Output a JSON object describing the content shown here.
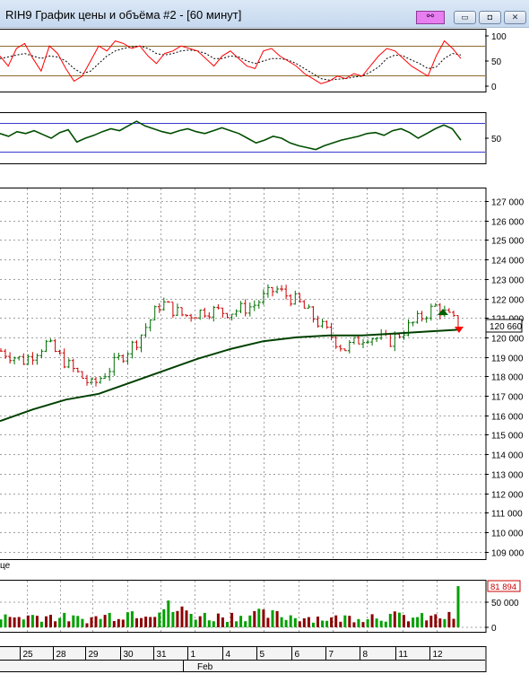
{
  "window": {
    "title": "RIH9 График цены и объёма #2 - [60 минут]",
    "link_icon": "link-icon",
    "buttons": {
      "minimize": "minimize-icon",
      "restore": "restore-icon",
      "close": "close-icon"
    }
  },
  "oscillator_panel": {
    "y_ticks": [
      "100",
      "50",
      "0"
    ],
    "colors": {
      "fast": "#ff0000",
      "slow": "#000000",
      "bands": "#8b6b2a"
    }
  },
  "momentum_panel": {
    "y_ticks": [
      "50"
    ],
    "colors": {
      "line": "#004d00",
      "bands": "#3a3acf"
    }
  },
  "price_panel": {
    "y_ticks": [
      "127 000",
      "126 000",
      "125 000",
      "124 000",
      "123 000",
      "122 000",
      "121 000",
      "120 000",
      "119 000",
      "118 000",
      "117 000",
      "116 000",
      "115 000",
      "114 000",
      "113 000",
      "112 000",
      "111 000",
      "110 000",
      "109 000"
    ],
    "last_price_label": "120 660",
    "bottom_left_fragment": "це",
    "colors": {
      "up": "#007000",
      "down": "#cc0000",
      "ma": "#004000",
      "grid": "#a0a0a0"
    }
  },
  "volume_panel": {
    "y_ticks": [
      "50 000",
      "0"
    ],
    "last_volume_label": "81 894",
    "colors": {
      "up": "#00a000",
      "down": "#8b0000"
    }
  },
  "date_axis": {
    "days": [
      "25",
      "28",
      "29",
      "30",
      "31",
      "1",
      "4",
      "5",
      "6",
      "7",
      "8",
      "11",
      "12"
    ],
    "month_label": "Feb"
  },
  "chart_data": [
    {
      "type": "line",
      "title": "",
      "y_ticks": [
        0,
        50,
        100
      ],
      "ylim": [
        0,
        100
      ],
      "series": [
        {
          "values": [
            60,
            40,
            75,
            85,
            55,
            30,
            80,
            65,
            35,
            10,
            20,
            50,
            80,
            70,
            90,
            85,
            75,
            80,
            60,
            45,
            65,
            70,
            80,
            75,
            70,
            55,
            40,
            60,
            70,
            55,
            40,
            35,
            70,
            75,
            60,
            50,
            40,
            25,
            15,
            5,
            10,
            20,
            15,
            25,
            20,
            40,
            60,
            75,
            70,
            55,
            40,
            30,
            20,
            60,
            90,
            75,
            55
          ]
        },
        {
          "values": [
            55,
            58,
            62,
            65,
            60,
            55,
            60,
            58,
            50,
            35,
            25,
            30,
            45,
            60,
            70,
            75,
            78,
            80,
            75,
            65,
            62,
            65,
            70,
            72,
            70,
            65,
            55,
            55,
            60,
            58,
            50,
            45,
            50,
            55,
            55,
            52,
            45,
            35,
            25,
            15,
            12,
            14,
            15,
            18,
            20,
            28,
            38,
            55,
            62,
            60,
            52,
            45,
            35,
            38,
            55,
            65,
            62
          ]
        }
      ]
    },
    {
      "type": "line",
      "title": "",
      "y_ticks": [
        50
      ],
      "series": [
        {
          "values": [
            55,
            52,
            57,
            55,
            58,
            54,
            50,
            56,
            59,
            46,
            50,
            53,
            57,
            60,
            58,
            63,
            68,
            63,
            60,
            57,
            55,
            58,
            60,
            57,
            55,
            58,
            61,
            58,
            55,
            50,
            45,
            48,
            52,
            50,
            45,
            42,
            40,
            38,
            42,
            45,
            48,
            50,
            52,
            55,
            56,
            53,
            58,
            60,
            56,
            50,
            55,
            60,
            64,
            60,
            48
          ]
        }
      ]
    },
    {
      "type": "line",
      "title": "",
      "ylim": [
        108500,
        127500
      ],
      "x": [
        "25",
        "28",
        "29",
        "30",
        "31",
        "1",
        "4",
        "5",
        "6",
        "7",
        "8",
        "11",
        "12"
      ],
      "series": [
        {
          "values": [
            119300,
            118800,
            119700,
            118500,
            117500,
            118700,
            119900,
            121800,
            121100,
            121400,
            121300,
            121600,
            122500,
            121800,
            120600,
            119400,
            120100,
            119800,
            120700,
            121600,
            120660
          ]
        },
        {
          "values": [
            115700,
            116300,
            116800,
            117100,
            117700,
            118300,
            118900,
            119400,
            119800,
            120000,
            120100,
            120100,
            120200,
            120300,
            120400
          ]
        }
      ]
    },
    {
      "type": "bar",
      "title": "",
      "y_ticks": [
        0,
        50000
      ],
      "categories": [
        "25",
        "28",
        "29",
        "30",
        "31",
        "1",
        "4",
        "5",
        "6",
        "7",
        "8",
        "11",
        "12"
      ],
      "series": [
        {
          "values": [
            22000,
            28000,
            18000,
            35000,
            45000,
            24000,
            30000,
            26000,
            20000,
            28000,
            22000,
            25000,
            81894
          ]
        }
      ]
    }
  ]
}
